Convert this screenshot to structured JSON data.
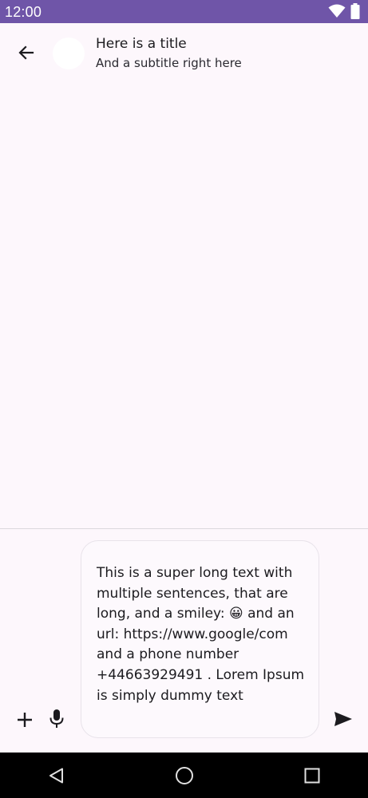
{
  "status_bar": {
    "time": "12:00",
    "icons": [
      "wifi-icon",
      "battery-icon"
    ],
    "background": "#6f55a8"
  },
  "header": {
    "back_icon": "arrow-back-icon",
    "title": "Here is a title",
    "subtitle": "And a subtitle right here"
  },
  "composer": {
    "attach_icon": "plus-icon",
    "mic_icon": "microphone-icon",
    "input_value": "This is a super long text with multiple sentences, that are long, and a smiley: 😀 and an url: https://www.google/com and a phone number +44663929491 . Lorem Ipsum is simply dummy text",
    "send_icon": "send-icon"
  },
  "nav_bar": {
    "icons": [
      "back-triangle-icon",
      "home-circle-icon",
      "recents-square-icon"
    ]
  },
  "colors": {
    "background": "#fdf7fc",
    "status_bar": "#6f55a8",
    "nav_bar": "#000000"
  }
}
